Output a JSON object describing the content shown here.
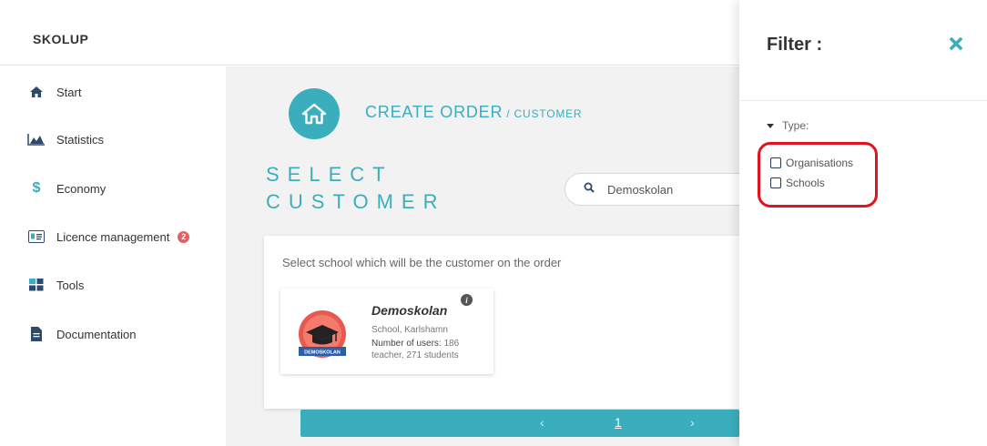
{
  "header": {
    "brand": "SKOLUP"
  },
  "sidebar": {
    "items": [
      {
        "label": "Start",
        "icon": "home-icon"
      },
      {
        "label": "Statistics",
        "icon": "area-chart-icon"
      },
      {
        "label": "Economy",
        "icon": "dollar-icon"
      },
      {
        "label": "Licence management",
        "icon": "id-card-icon",
        "badge": "2"
      },
      {
        "label": "Tools",
        "icon": "grid-icon"
      },
      {
        "label": "Documentation",
        "icon": "document-icon"
      }
    ]
  },
  "main": {
    "breadcrumb": {
      "title": "CREATE ORDER",
      "sub": "/ CUSTOMER"
    },
    "heading": {
      "line1": "SELECT",
      "line2": "CUSTOMER"
    },
    "search": {
      "value": "Demoskolan"
    },
    "hint": "Select school which will be the customer on the order",
    "card": {
      "title": "Demoskolan",
      "info": "i",
      "location": "School, Karlshamn",
      "users_label": "Number of users:",
      "users_value": "186 teacher, 271 students",
      "logo_text": "DEMOSKOLAN"
    },
    "pagination": {
      "prev": "‹",
      "page": "1",
      "next": "›"
    }
  },
  "filter": {
    "title": "Filter :",
    "close": "✖",
    "type_label": "Type:",
    "options": [
      {
        "label": "Organisations",
        "checked": false
      },
      {
        "label": "Schools",
        "checked": false
      }
    ]
  },
  "colors": {
    "accent": "#3aaebc",
    "badge": "#e4605e",
    "annotation": "#e0141e"
  }
}
